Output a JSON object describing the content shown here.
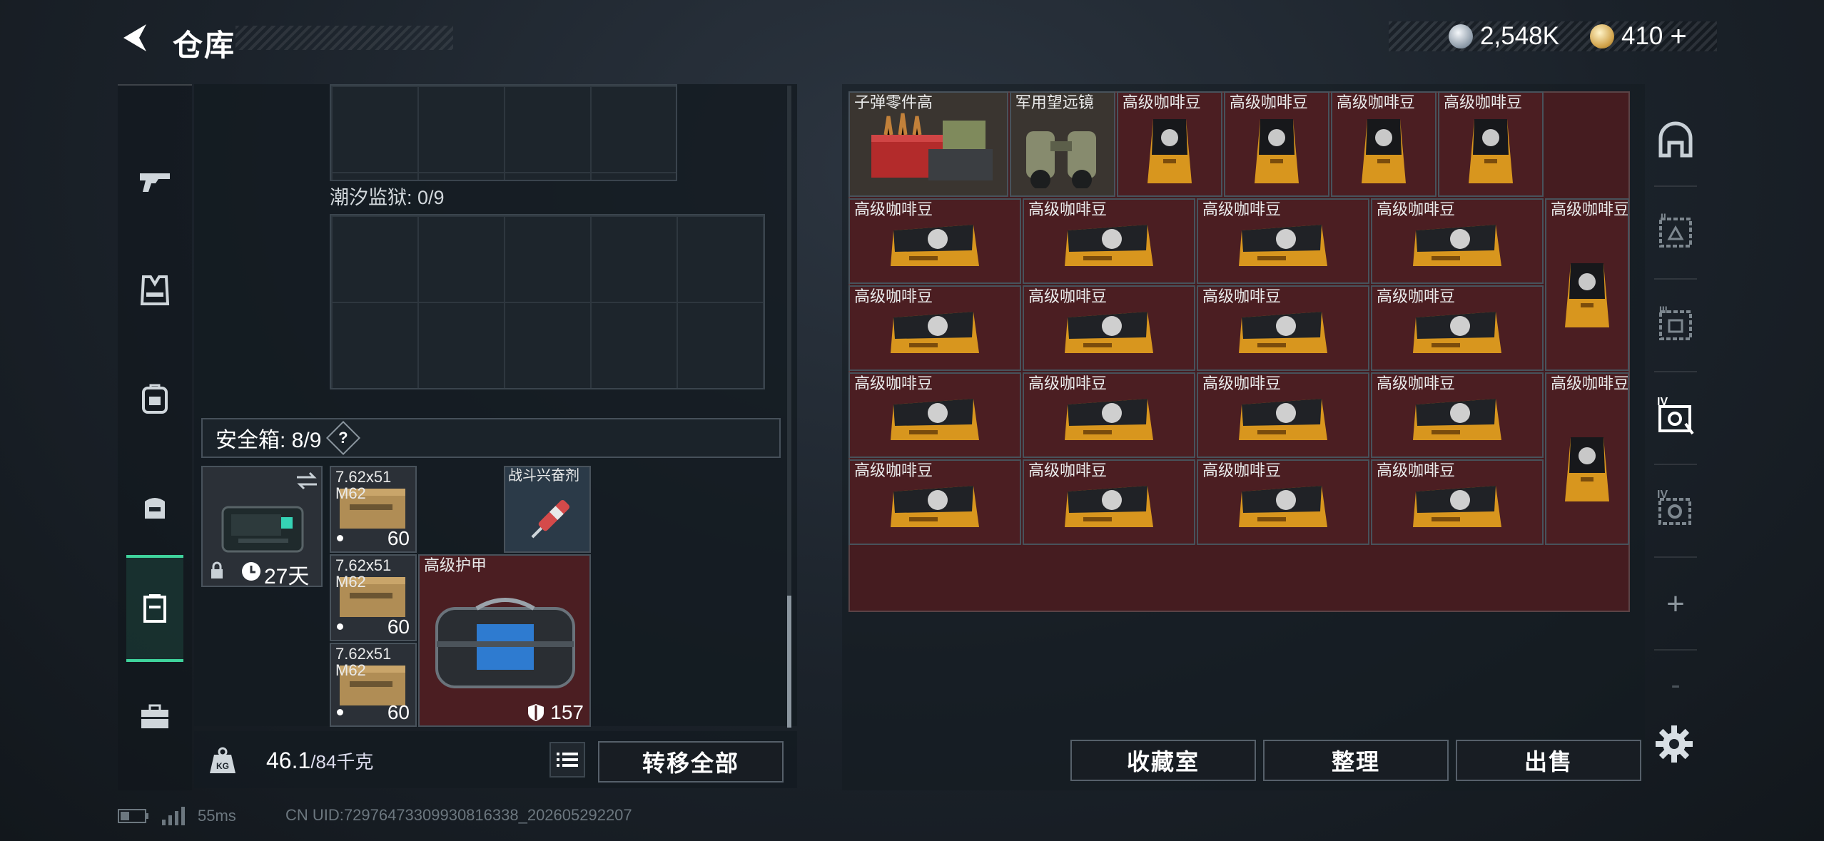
{
  "header": {
    "title": "仓库",
    "silver_amount": "2,548K",
    "gold_amount": "410",
    "gold_plus": "+"
  },
  "left_rail": {
    "items": [
      {
        "icon": "gun-icon"
      },
      {
        "icon": "vest-icon"
      },
      {
        "icon": "backpack-icon"
      },
      {
        "icon": "bag-icon"
      },
      {
        "icon": "safe-case-icon",
        "active": true
      },
      {
        "icon": "briefcase-icon"
      }
    ]
  },
  "containers": {
    "tide_prison_label": "潮汐监狱: 0/9",
    "safe_box_label": "安全箱: 8/9",
    "safe_box_help": "?"
  },
  "safe_case": {
    "days": "27天"
  },
  "safe_items": [
    {
      "name": "7.62x51\nM62",
      "count": "60"
    },
    {
      "name": "战斗兴奋剂",
      "count": ""
    },
    {
      "name": "7.62x51\nM62",
      "count": "60"
    },
    {
      "name": "高级护甲",
      "count": "157"
    },
    {
      "name": "7.62x51\nM62",
      "count": "60"
    }
  ],
  "weight": {
    "current": "46.1",
    "max": "/84千克"
  },
  "buttons": {
    "transfer_all": "转移全部",
    "collection_room": "收藏室",
    "organize": "整理",
    "sell": "出售"
  },
  "stash_items": {
    "parts": "子弹零件高",
    "binoculars": "军用望远镜",
    "coffee": "高级咖啡豆"
  },
  "right_rail": {
    "items": [
      {
        "icon": "tab-home-icon"
      },
      {
        "icon": "stash-tab-ii-icon",
        "label": "II"
      },
      {
        "icon": "stash-tab-iii-icon",
        "label": "III"
      },
      {
        "icon": "stash-tab-iv-a-icon",
        "label": "IV"
      },
      {
        "icon": "stash-tab-iv-b-icon",
        "label": "IV"
      },
      {
        "icon": "add-tab-icon",
        "label": "+"
      },
      {
        "icon": "remove-tab-icon",
        "label": "-"
      }
    ]
  },
  "status": {
    "ping": "55ms",
    "uid": "CN UID:72976473309930816338_202605292207"
  },
  "colors": {
    "accent": "#3fd39c",
    "item_red": "#4b1e22",
    "panel": "#1d252c"
  }
}
